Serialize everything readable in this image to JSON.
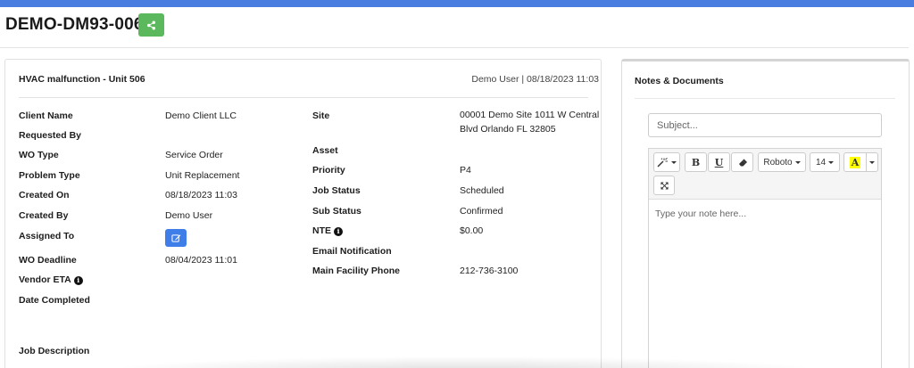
{
  "header": {
    "title": "DEMO-DM93-006",
    "share_icon": "share-icon",
    "accent_color": "#4a7de0",
    "share_color": "#5cb85c"
  },
  "work_order": {
    "title": "HVAC malfunction - Unit 506",
    "meta": "Demo User | 08/18/2023 11:03",
    "left_fields": [
      {
        "label": "Client Name",
        "value": "Demo Client LLC"
      },
      {
        "label": "Requested By",
        "value": ""
      },
      {
        "label": "WO Type",
        "value": "Service Order"
      },
      {
        "label": "Problem Type",
        "value": "Unit Replacement"
      },
      {
        "label": "Created On",
        "value": "08/18/2023 11:03"
      },
      {
        "label": "Created By",
        "value": "Demo User"
      },
      {
        "label": "Assigned To",
        "value": ""
      },
      {
        "label": "WO Deadline",
        "value": "08/04/2023 11:01"
      },
      {
        "label": "Vendor ETA",
        "value": ""
      },
      {
        "label": "Date Completed",
        "value": ""
      }
    ],
    "right_fields": [
      {
        "label": "Site",
        "value": "00001 Demo Site 1011 W Central Blvd Orlando FL 32805"
      },
      {
        "label": "Asset",
        "value": ""
      },
      {
        "label": "Priority",
        "value": "P4"
      },
      {
        "label": "Job Status",
        "value": "Scheduled"
      },
      {
        "label": "Sub Status",
        "value": "Confirmed"
      },
      {
        "label": "NTE",
        "value": "$0.00"
      },
      {
        "label": "Email Notification",
        "value": ""
      },
      {
        "label": "Main Facility Phone",
        "value": "212-736-3100"
      }
    ],
    "job_description_label": "Job Description",
    "edit_icon": "edit-icon",
    "info_icon": "info-icon",
    "edit_color": "#3f7ee8"
  },
  "notes": {
    "title": "Notes & Documents",
    "subject_placeholder": "Subject...",
    "note_placeholder": "Type your note here...",
    "toolbar": {
      "magic_icon": "magic-wand-icon",
      "bold_label": "B",
      "underline_label": "U",
      "eraser_icon": "eraser-icon",
      "font_label": "Roboto",
      "size_label": "14",
      "color_label": "A",
      "fullscreen_icon": "expand-icon"
    }
  }
}
